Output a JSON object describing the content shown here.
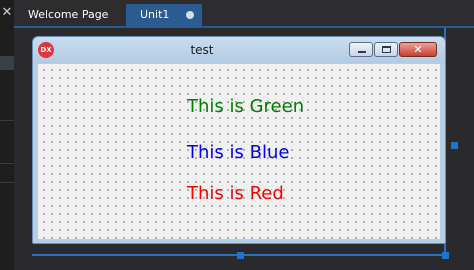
{
  "tabs": [
    {
      "label": "Welcome Page",
      "active": false
    },
    {
      "label": "Unit1",
      "active": true,
      "modified_indicator": "dot-icon"
    }
  ],
  "form": {
    "title": "test",
    "icon_text": "DX",
    "buttons": {
      "minimize": "minimize-icon",
      "maximize": "maximize-icon",
      "close": "close-icon"
    },
    "labels": [
      {
        "text": "This is Green",
        "color": "#008000"
      },
      {
        "text": "This is Blue",
        "color": "#0000ff"
      },
      {
        "text": "This is Red",
        "color": "#ff0000"
      }
    ]
  },
  "colors": {
    "accent": "#1f73d1",
    "active_tab": "#2b5b93",
    "background": "#252526"
  },
  "left_strip": {
    "close_glyph": "✕"
  }
}
